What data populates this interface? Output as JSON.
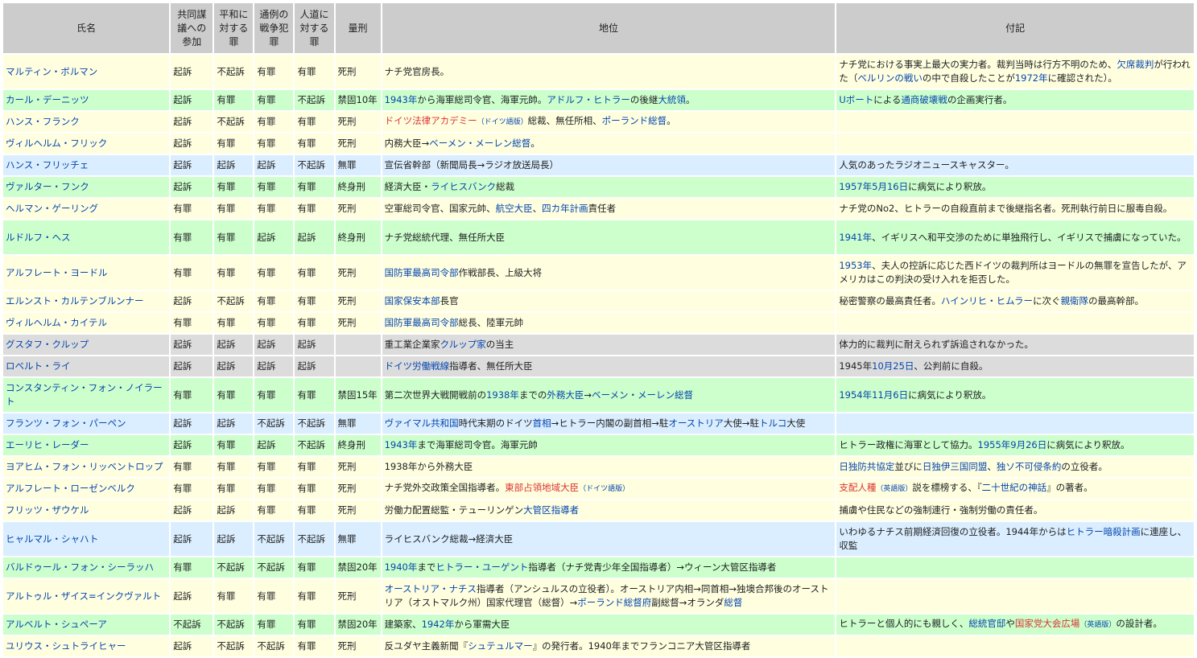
{
  "headers": [
    "氏名",
    "共同謀議への参加",
    "平和に対する罪",
    "通例の戦争犯罪",
    "人道に対する罪",
    "量刑",
    "地位",
    "付記"
  ],
  "rows": [
    {
      "c": "y",
      "tall": true,
      "name": "マルティン・ボルマン",
      "c1": "起訴",
      "c2": "不起訴",
      "c3": "有罪",
      "c4": "有罪",
      "sentence": "死刑",
      "pos": [
        {
          "t": "ナチ党官房長。"
        }
      ],
      "note": [
        {
          "t": "ナチ党における事実上最大の実力者。裁判当時は行方不明のため、"
        },
        {
          "t": "欠席裁判",
          "k": "link"
        },
        {
          "t": "が行われた（"
        },
        {
          "t": "ベルリンの戦い",
          "k": "link"
        },
        {
          "t": "の中で自殺したことが"
        },
        {
          "t": "1972年",
          "k": "link"
        },
        {
          "t": "に確認された）。"
        }
      ]
    },
    {
      "c": "g",
      "name": "カール・デーニッツ",
      "c1": "起訴",
      "c2": "有罪",
      "c3": "有罪",
      "c4": "不起訴",
      "sentence": "禁固10年",
      "pos": [
        {
          "t": "1943年",
          "k": "link"
        },
        {
          "t": "から海軍総司令官、海軍元帥。"
        },
        {
          "t": "アドルフ・ヒトラー",
          "k": "link"
        },
        {
          "t": "の後継"
        },
        {
          "t": "大統領",
          "k": "link"
        },
        {
          "t": "。"
        }
      ],
      "note": [
        {
          "t": "Uボート",
          "k": "link"
        },
        {
          "t": "による"
        },
        {
          "t": "通商破壊戦",
          "k": "link"
        },
        {
          "t": "の企画実行者。"
        }
      ]
    },
    {
      "c": "y",
      "name": "ハンス・フランク",
      "c1": "起訴",
      "c2": "不起訴",
      "c3": "有罪",
      "c4": "有罪",
      "sentence": "死刑",
      "pos": [
        {
          "t": "ドイツ法律アカデミー",
          "k": "red"
        },
        {
          "t": "（ドイツ語版）",
          "k": "small"
        },
        {
          "t": "総裁、無任所相、"
        },
        {
          "t": "ポーランド総督",
          "k": "link"
        },
        {
          "t": "。"
        }
      ],
      "note": []
    },
    {
      "c": "y",
      "name": "ヴィルヘルム・フリック",
      "c1": "起訴",
      "c2": "有罪",
      "c3": "有罪",
      "c4": "有罪",
      "sentence": "死刑",
      "pos": [
        {
          "t": "内務大臣→"
        },
        {
          "t": "ベーメン・メーレン総督",
          "k": "link"
        },
        {
          "t": "。"
        }
      ],
      "note": []
    },
    {
      "c": "b",
      "name": "ハンス・フリッチェ",
      "c1": "起訴",
      "c2": "起訴",
      "c3": "起訴",
      "c4": "不起訴",
      "sentence": "無罪",
      "pos": [
        {
          "t": "宣伝省幹部（新聞局長→ラジオ放送局長）"
        }
      ],
      "note": [
        {
          "t": "人気のあったラジオニュースキャスター。"
        }
      ]
    },
    {
      "c": "g",
      "name": "ヴァルター・フンク",
      "c1": "起訴",
      "c2": "有罪",
      "c3": "有罪",
      "c4": "有罪",
      "sentence": "終身刑",
      "pos": [
        {
          "t": "経済大臣・"
        },
        {
          "t": "ライヒスバンク",
          "k": "link"
        },
        {
          "t": "総裁"
        }
      ],
      "note": [
        {
          "t": "1957年5月16日",
          "k": "link"
        },
        {
          "t": "に病気により釈放。"
        }
      ]
    },
    {
      "c": "y",
      "name": "ヘルマン・ゲーリング",
      "c1": "有罪",
      "c2": "有罪",
      "c3": "有罪",
      "c4": "有罪",
      "sentence": "死刑",
      "pos": [
        {
          "t": "空軍総司令官、国家元帥、"
        },
        {
          "t": "航空大臣",
          "k": "link"
        },
        {
          "t": "、"
        },
        {
          "t": "四カ年計画",
          "k": "link"
        },
        {
          "t": "責任者"
        }
      ],
      "note": [
        {
          "t": "ナチ党のNo2、ヒトラーの自殺直前まで後継指名者。死刑執行前日に服毒自殺。"
        }
      ]
    },
    {
      "c": "g",
      "tall": true,
      "name": "ルドルフ・ヘス",
      "c1": "有罪",
      "c2": "有罪",
      "c3": "起訴",
      "c4": "起訴",
      "sentence": "終身刑",
      "pos": [
        {
          "t": "ナチ党総統代理、無任所大臣"
        }
      ],
      "note": [
        {
          "t": "1941年",
          "k": "link"
        },
        {
          "t": "、イギリスへ和平交渉のために単独飛行し、イギリスで捕虜になっていた。"
        }
      ]
    },
    {
      "c": "y",
      "tall": true,
      "name": "アルフレート・ヨードル",
      "c1": "有罪",
      "c2": "有罪",
      "c3": "有罪",
      "c4": "有罪",
      "sentence": "死刑",
      "pos": [
        {
          "t": "国防軍最高司令部",
          "k": "link"
        },
        {
          "t": "作戦部長、上級大将"
        }
      ],
      "note": [
        {
          "t": "1953年",
          "k": "link"
        },
        {
          "t": "、夫人の控訴に応じた西ドイツの裁判所はヨードルの無罪を宣告したが、アメリカはこの判決の受け入れを拒否した。"
        }
      ]
    },
    {
      "c": "y",
      "name": "エルンスト・カルテンブルンナー",
      "c1": "起訴",
      "c2": "不起訴",
      "c3": "有罪",
      "c4": "有罪",
      "sentence": "死刑",
      "pos": [
        {
          "t": "国家保安本部",
          "k": "link"
        },
        {
          "t": "長官"
        }
      ],
      "note": [
        {
          "t": "秘密警察の最高責任者。"
        },
        {
          "t": "ハインリヒ・ヒムラー",
          "k": "link"
        },
        {
          "t": "に次ぐ"
        },
        {
          "t": "親衛隊",
          "k": "link"
        },
        {
          "t": "の最高幹部。"
        }
      ]
    },
    {
      "c": "y",
      "name": "ヴィルヘルム・カイテル",
      "c1": "有罪",
      "c2": "有罪",
      "c3": "有罪",
      "c4": "有罪",
      "sentence": "死刑",
      "pos": [
        {
          "t": "国防軍最高司令部",
          "k": "link"
        },
        {
          "t": "総長、陸軍元帥"
        }
      ],
      "note": []
    },
    {
      "c": "k",
      "name": "グスタフ・クルップ",
      "c1": "起訴",
      "c2": "起訴",
      "c3": "起訴",
      "c4": "起訴",
      "sentence": "",
      "pos": [
        {
          "t": "重工業企業家"
        },
        {
          "t": "クルップ家",
          "k": "link"
        },
        {
          "t": "の当主"
        }
      ],
      "note": [
        {
          "t": "体力的に裁判に耐えられず訴追されなかった。"
        }
      ]
    },
    {
      "c": "k",
      "name": "ロベルト・ライ",
      "c1": "起訴",
      "c2": "起訴",
      "c3": "起訴",
      "c4": "起訴",
      "sentence": "",
      "pos": [
        {
          "t": "ドイツ労働戦線",
          "k": "link"
        },
        {
          "t": "指導者、無任所大臣"
        }
      ],
      "note": [
        {
          "t": "1945年"
        },
        {
          "t": "10月25日",
          "k": "link"
        },
        {
          "t": "、公判前に自殺。"
        }
      ]
    },
    {
      "c": "g",
      "tall": true,
      "name": "コンスタンティン・フォン・ノイラート",
      "c1": "有罪",
      "c2": "有罪",
      "c3": "有罪",
      "c4": "有罪",
      "sentence": "禁固15年",
      "pos": [
        {
          "t": "第二次世界大戦開戦前の"
        },
        {
          "t": "1938年",
          "k": "link"
        },
        {
          "t": "までの"
        },
        {
          "t": "外務大臣",
          "k": "link"
        },
        {
          "t": "→"
        },
        {
          "t": "ベーメン・メーレン総督",
          "k": "link"
        }
      ],
      "note": [
        {
          "t": "1954年11月6日",
          "k": "link"
        },
        {
          "t": "に病気により釈放。"
        }
      ]
    },
    {
      "c": "b",
      "name": "フランツ・フォン・パーペン",
      "c1": "起訴",
      "c2": "起訴",
      "c3": "不起訴",
      "c4": "不起訴",
      "sentence": "無罪",
      "pos": [
        {
          "t": "ヴァイマル共和国",
          "k": "link"
        },
        {
          "t": "時代末期のドイツ"
        },
        {
          "t": "首相",
          "k": "link"
        },
        {
          "t": "→ヒトラー内閣の副首相→駐"
        },
        {
          "t": "オーストリア",
          "k": "link"
        },
        {
          "t": "大使→駐"
        },
        {
          "t": "トルコ",
          "k": "link"
        },
        {
          "t": "大使"
        }
      ],
      "note": []
    },
    {
      "c": "g",
      "name": "エーリヒ・レーダー",
      "c1": "起訴",
      "c2": "有罪",
      "c3": "起訴",
      "c4": "不起訴",
      "sentence": "終身刑",
      "pos": [
        {
          "t": "1943年",
          "k": "link"
        },
        {
          "t": "まで海軍総司令官。海軍元帥"
        }
      ],
      "note": [
        {
          "t": "ヒトラー政権に海軍として協力。"
        },
        {
          "t": "1955年9月26日",
          "k": "link"
        },
        {
          "t": "に病気により釈放。"
        }
      ]
    },
    {
      "c": "y",
      "name": "ヨアヒム・フォン・リッベントロップ",
      "c1": "有罪",
      "c2": "有罪",
      "c3": "有罪",
      "c4": "有罪",
      "sentence": "死刑",
      "pos": [
        {
          "t": "1938年から外務大臣"
        }
      ],
      "note": [
        {
          "t": "日独防共協定",
          "k": "link"
        },
        {
          "t": "並びに"
        },
        {
          "t": "日独伊三国同盟",
          "k": "link"
        },
        {
          "t": "、"
        },
        {
          "t": "独ソ不可侵条約",
          "k": "link"
        },
        {
          "t": "の立役者。"
        }
      ]
    },
    {
      "c": "y",
      "name": "アルフレート・ローゼンベルク",
      "c1": "有罪",
      "c2": "有罪",
      "c3": "有罪",
      "c4": "有罪",
      "sentence": "死刑",
      "pos": [
        {
          "t": "ナチ党外交政策全国指導者。"
        },
        {
          "t": "東部占領地域大臣",
          "k": "red"
        },
        {
          "t": "（ドイツ語版）",
          "k": "small"
        }
      ],
      "note": [
        {
          "t": "支配人種",
          "k": "red"
        },
        {
          "t": "（英語版）",
          "k": "small"
        },
        {
          "t": "説を標榜する、『"
        },
        {
          "t": "二十世紀の神話",
          "k": "link"
        },
        {
          "t": "』の著者。"
        }
      ]
    },
    {
      "c": "y",
      "name": "フリッツ・ザウケル",
      "c1": "起訴",
      "c2": "起訴",
      "c3": "有罪",
      "c4": "有罪",
      "sentence": "死刑",
      "pos": [
        {
          "t": "労働力配置総監・テューリンゲン"
        },
        {
          "t": "大管区指導者",
          "k": "link"
        }
      ],
      "note": [
        {
          "t": "捕虜や住民などの強制連行・強制労働の責任者。"
        }
      ]
    },
    {
      "c": "b",
      "tall": true,
      "name": "ヒャルマル・シャハト",
      "c1": "起訴",
      "c2": "起訴",
      "c3": "不起訴",
      "c4": "不起訴",
      "sentence": "無罪",
      "pos": [
        {
          "t": "ライヒスバンク総裁→経済大臣"
        }
      ],
      "note": [
        {
          "t": "いわゆるナチス前期経済回復の立役者。1944年からは"
        },
        {
          "t": "ヒトラー暗殺計画",
          "k": "link"
        },
        {
          "t": "に連座し、収監"
        }
      ]
    },
    {
      "c": "g",
      "name": "バルドゥール・フォン・シーラッハ",
      "c1": "有罪",
      "c2": "不起訴",
      "c3": "不起訴",
      "c4": "有罪",
      "sentence": "禁固20年",
      "pos": [
        {
          "t": "1940年",
          "k": "link"
        },
        {
          "t": "まで"
        },
        {
          "t": "ヒトラー・ユーゲント",
          "k": "link"
        },
        {
          "t": "指導者（ナチ党青少年全国指導者）→ウィーン大管区指導者"
        }
      ],
      "note": []
    },
    {
      "c": "y",
      "tall": true,
      "name": "アルトゥル・ザイス=インクヴァルト",
      "c1": "起訴",
      "c2": "有罪",
      "c3": "有罪",
      "c4": "有罪",
      "sentence": "死刑",
      "pos": [
        {
          "t": "オーストリア・ナチス",
          "k": "link"
        },
        {
          "t": "指導者（アンシュルスの立役者）。オーストリア内相→同首相→独墺合邦後のオーストリア（オストマルク州）国家代理官（総督）→"
        },
        {
          "t": "ポーランド総督府",
          "k": "link"
        },
        {
          "t": "副総督→オランダ"
        },
        {
          "t": "総督",
          "k": "link"
        }
      ],
      "note": []
    },
    {
      "c": "g",
      "name": "アルベルト・シュペーア",
      "c1": "不起訴",
      "c2": "不起訴",
      "c3": "有罪",
      "c4": "有罪",
      "sentence": "禁固20年",
      "pos": [
        {
          "t": "建築家、"
        },
        {
          "t": "1942年",
          "k": "link"
        },
        {
          "t": "から軍需大臣"
        }
      ],
      "note": [
        {
          "t": "ヒトラーと個人的にも親しく、"
        },
        {
          "t": "総統官邸",
          "k": "link"
        },
        {
          "t": "や"
        },
        {
          "t": "国家党大会広場",
          "k": "red"
        },
        {
          "t": "（英語版）",
          "k": "small"
        },
        {
          "t": "の設計者。"
        }
      ]
    },
    {
      "c": "y",
      "name": "ユリウス・シュトライヒャー",
      "c1": "起訴",
      "c2": "不起訴",
      "c3": "不起訴",
      "c4": "有罪",
      "sentence": "死刑",
      "pos": [
        {
          "t": "反ユダヤ主義新聞『"
        },
        {
          "t": "シュテュルマー",
          "k": "link"
        },
        {
          "t": "』の発行者。1940年までフランコニア大管区指導者"
        }
      ],
      "note": []
    }
  ]
}
